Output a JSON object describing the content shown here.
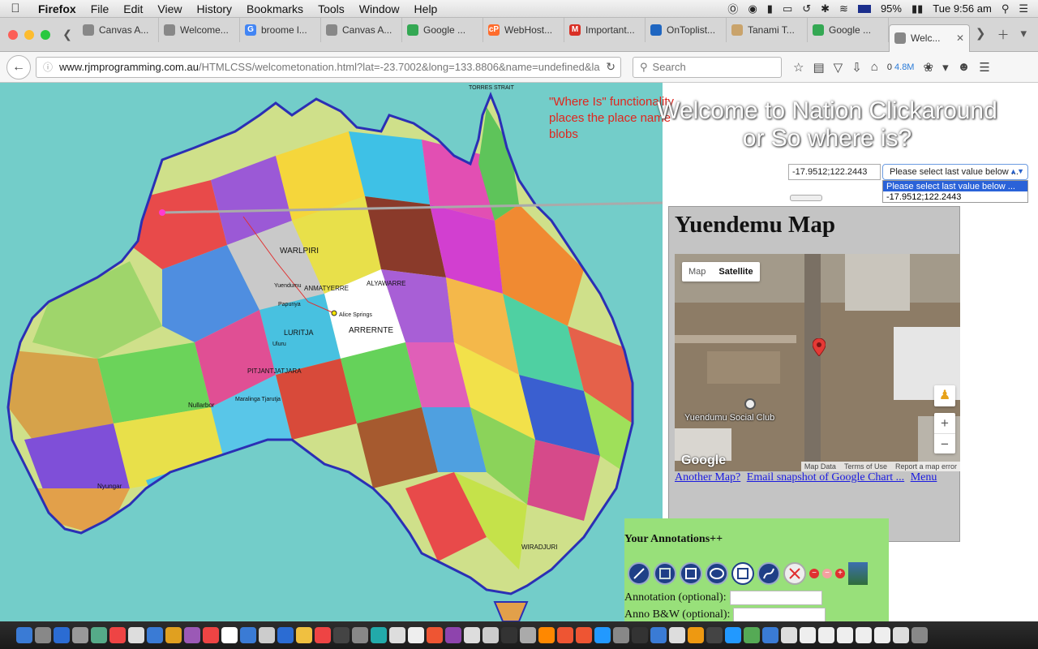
{
  "menubar": {
    "app": "Firefox",
    "items": [
      "File",
      "Edit",
      "View",
      "History",
      "Bookmarks",
      "Tools",
      "Window",
      "Help"
    ],
    "battery": "95%",
    "clock": "Tue 9:56 am"
  },
  "tabs": [
    {
      "label": "Canvas A...",
      "favicon_color": "#888888",
      "favicon_char": ""
    },
    {
      "label": "Welcome...",
      "favicon_color": "#888888",
      "favicon_char": ""
    },
    {
      "label": "broome l...",
      "favicon_color": "#4285f4",
      "favicon_char": "G"
    },
    {
      "label": "Canvas A...",
      "favicon_color": "#888888",
      "favicon_char": ""
    },
    {
      "label": "Google ...",
      "favicon_color": "#34a853",
      "favicon_char": ""
    },
    {
      "label": "WebHost...",
      "favicon_color": "#ff6c2c",
      "favicon_char": "cP"
    },
    {
      "label": "Important...",
      "favicon_color": "#d93025",
      "favicon_char": "M"
    },
    {
      "label": "OnToplist...",
      "favicon_color": "#1f66c1",
      "favicon_char": ""
    },
    {
      "label": "Tanami T...",
      "favicon_color": "#c9a36b",
      "favicon_char": ""
    },
    {
      "label": "Google ...",
      "favicon_color": "#34a853",
      "favicon_char": ""
    },
    {
      "label": "Welc...",
      "favicon_color": "#888888",
      "favicon_char": "",
      "active": true
    }
  ],
  "navbar": {
    "url_host": "www.rjmprogramming.com.au",
    "url_path": "/HTMLCSS/welcometonation.html?lat=-23.7002&long=133.8806&name=undefined&la",
    "search_placeholder": "Search",
    "count_zero": "0",
    "count_value": "4.8M"
  },
  "page": {
    "note": "\"Where Is\" functionality places the place name blobs",
    "welcome": "Welcome to Nation Clickaround or So where is?",
    "coord_value": "-17.9512;122.2443",
    "select": {
      "selected": "Please select last value below ...",
      "options": [
        "Please select last value below ...",
        "-17.9512;122.2443"
      ]
    }
  },
  "map_labels": {
    "top_strait": "TORRES STRAIT",
    "nation_1": "WARLPIRI",
    "nation_2": "ANMATYERRE",
    "nation_3": "ALYAWARRE",
    "nation_4": "LURITJA",
    "nation_5": "ARRERNTE",
    "nation_6": "PITJANTJATJARA",
    "nation_7": "Nyungar",
    "nation_8": "WIRADJURI",
    "town_1": "Yuendumu",
    "town_2": "Alice Springs",
    "town_3": "Uluru",
    "town_4": "Papunya",
    "region_1": "Nullarbor",
    "region_2": "Maralinga Tjarutja"
  },
  "map_panel": {
    "title": "Yuendemu Map",
    "maptype_map": "Map",
    "maptype_satellite": "Satellite",
    "poi_label": "Yuendumu Social Club",
    "google": "Google",
    "attribution": [
      "Map Data",
      "Terms of Use",
      "Report a map error"
    ],
    "links": [
      "Another Map?",
      "Email snapshot of Google Chart ...",
      "Menu"
    ]
  },
  "annotations": {
    "title": "Your Annotations++",
    "annotation_label": "Annotation (optional):",
    "annobw_label": "Anno B&W (optional):"
  },
  "colors": {
    "ocean": "#73cdc9",
    "note_red": "#e0261e",
    "panel_grey": "#c4c4c4",
    "annot_green": "#98e07a",
    "coast_blue": "#2b2fb5"
  },
  "dock_colors": [
    "#3a7bd5",
    "#888",
    "#2b6cd3",
    "#999",
    "#5a8",
    "#e44",
    "#ddd",
    "#3a7bd5",
    "#e0a020",
    "#9b59b6",
    "#e44",
    "#fff",
    "#3a7bd5",
    "#ccc",
    "#2b6cd3",
    "#f0c040",
    "#e44",
    "#444",
    "#888",
    "#2aa",
    "#ddd",
    "#eee",
    "#e53",
    "#8e44ad",
    "#ddd",
    "#ccc",
    "#333",
    "#aaa",
    "#f80",
    "#e53",
    "#e53",
    "#29f",
    "#888",
    "#333",
    "#3a7bd5",
    "#ddd",
    "#e91",
    "#444",
    "#29f",
    "#5a5",
    "#3a7bd5",
    "#ddd",
    "#eee",
    "#eee",
    "#eee",
    "#eee",
    "#eee",
    "#ddd",
    "#888"
  ]
}
